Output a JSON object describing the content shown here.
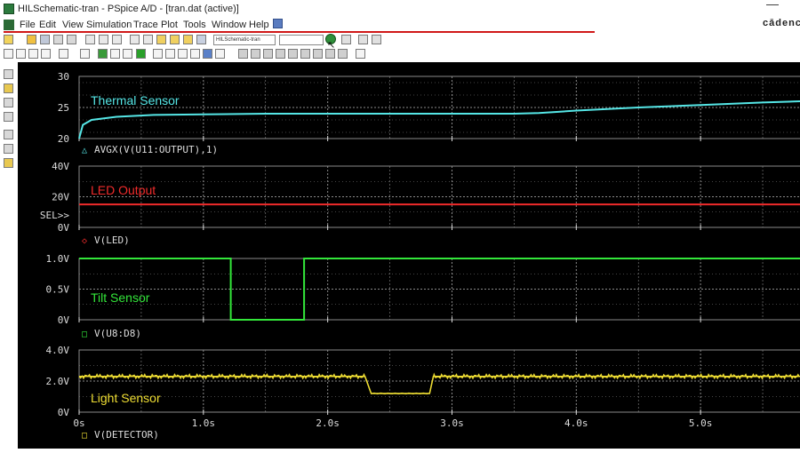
{
  "window": {
    "title": "HILSchematic-tran - PSpice A/D - [tran.dat (active)]",
    "brand": "cādenc"
  },
  "menu": [
    "File",
    "Edit",
    "View",
    "Simulation",
    "Trace",
    "Plot",
    "Tools",
    "Window",
    "Help"
  ],
  "toolbar": {
    "profile_value": "HILSchematic-tran",
    "search_value": ""
  },
  "colors": {
    "plot_bg": "#000000",
    "grid": "#8a8a8a",
    "axis_text": "#dcdcdc",
    "thermal": "#55e6e6",
    "led": "#ef2b2b",
    "tilt": "#33e63a",
    "light": "#eedd33",
    "menu_accent": "#d01818"
  },
  "x_axis": {
    "ticks": [
      "0s",
      "1.0s",
      "2.0s",
      "3.0s",
      "4.0s",
      "5.0s"
    ]
  },
  "traces": [
    {
      "id": "thermal",
      "label": "Thermal Sensor",
      "trace_name": "AVGX(V(U11:OUTPUT),1)",
      "marker": "△",
      "ticks": [
        "30",
        "25",
        "20"
      ]
    },
    {
      "id": "led",
      "label": "LED Output",
      "trace_name": "V(LED)",
      "marker": "◇",
      "selected_marker": "SEL>>",
      "ticks": [
        "40V",
        "20V",
        "0V"
      ]
    },
    {
      "id": "tilt",
      "label": "Tilt Sensor",
      "trace_name": "V(U8:D8)",
      "marker": "□",
      "ticks": [
        "1.0V",
        "0.5V",
        "0V"
      ]
    },
    {
      "id": "light",
      "label": "Light Sensor",
      "trace_name": "V(DETECTOR)",
      "marker": "□",
      "ticks": [
        "4.0V",
        "2.0V",
        "0V"
      ]
    }
  ],
  "chart_data": [
    {
      "type": "line",
      "title": "",
      "xlabel": "",
      "ylabel": "",
      "xlim": [
        0,
        5.8
      ],
      "ylim": [
        20,
        30
      ],
      "series": [
        {
          "name": "AVGX(V(U11:OUTPUT),1)",
          "x": [
            0,
            0.03,
            0.1,
            0.3,
            0.6,
            1.0,
            1.5,
            2.0,
            2.5,
            3.0,
            3.5,
            3.7,
            4.0,
            4.5,
            5.0,
            5.5,
            5.8
          ],
          "y": [
            20,
            22.2,
            23.0,
            23.5,
            23.8,
            23.9,
            24.0,
            24.0,
            24.0,
            24.0,
            24.0,
            24.1,
            24.5,
            25.0,
            25.4,
            25.8,
            26.0
          ]
        }
      ]
    },
    {
      "type": "line",
      "title": "",
      "xlabel": "",
      "ylabel": "",
      "xlim": [
        0,
        5.8
      ],
      "ylim": [
        0,
        40
      ],
      "series": [
        {
          "name": "V(LED)",
          "x": [
            0,
            5.8
          ],
          "y": [
            15,
            15
          ]
        }
      ]
    },
    {
      "type": "line",
      "title": "",
      "xlabel": "",
      "ylabel": "",
      "xlim": [
        0,
        5.8
      ],
      "ylim": [
        0,
        1.0
      ],
      "series": [
        {
          "name": "V(U8:D8)",
          "x": [
            0,
            1.22,
            1.22,
            1.81,
            1.81,
            5.8
          ],
          "y": [
            1.0,
            1.0,
            0,
            0,
            1.0,
            1.0
          ]
        }
      ]
    },
    {
      "type": "line",
      "title": "",
      "xlabel": "",
      "ylabel": "",
      "xlim": [
        0,
        5.8
      ],
      "ylim": [
        0,
        4.0
      ],
      "series": [
        {
          "name": "V(DETECTOR)",
          "x": [
            0,
            2.3,
            2.35,
            2.82,
            2.85,
            5.8
          ],
          "y": [
            2.3,
            2.3,
            1.2,
            1.2,
            2.3,
            2.3
          ]
        }
      ]
    }
  ]
}
